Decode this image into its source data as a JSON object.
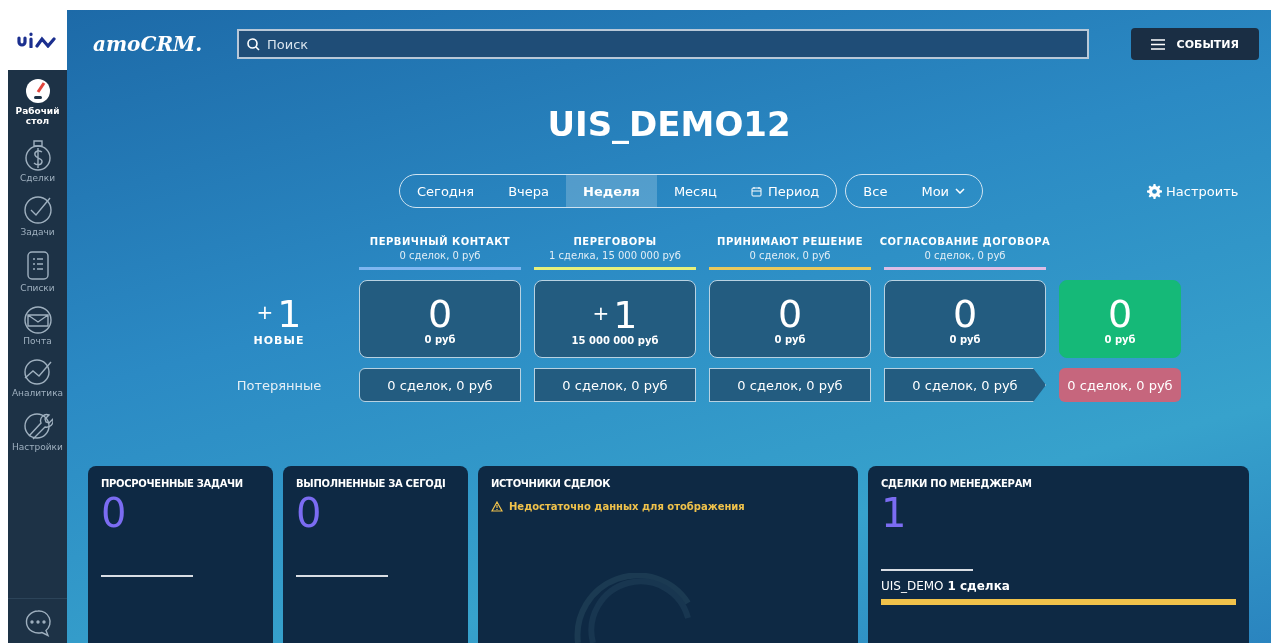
{
  "sidebar": {
    "items": [
      {
        "label": "Рабочий стол",
        "selected": true
      },
      {
        "label": "Сделки",
        "selected": false
      },
      {
        "label": "Задачи",
        "selected": false
      },
      {
        "label": "Списки",
        "selected": false
      },
      {
        "label": "Почта",
        "selected": false
      },
      {
        "label": "Аналитика",
        "selected": false
      },
      {
        "label": "Настройки",
        "selected": false
      }
    ]
  },
  "header": {
    "brand": "amoCRM.",
    "search": {
      "placeholder": "Поиск"
    },
    "events_button": "СОБЫТИЯ"
  },
  "title": "UIS_DEMO12",
  "period_tabs": [
    {
      "label": "Сегодня",
      "selected": false
    },
    {
      "label": "Вчера",
      "selected": false
    },
    {
      "label": "Неделя",
      "selected": true
    },
    {
      "label": "Месяц",
      "selected": false
    },
    {
      "label": "Период",
      "selected": false,
      "kind": "calendar"
    }
  ],
  "owner_tabs": [
    {
      "label": "Все",
      "selected": false
    },
    {
      "label": "Мои",
      "selected": false,
      "kind": "dropdown"
    }
  ],
  "configure_button": "Настроить",
  "new_deals": {
    "prefix": "+",
    "count": "1",
    "label": "НОВЫЕ"
  },
  "lost_label": "Потерянные",
  "stages": [
    {
      "name": "ПЕРВИЧНЫЙ КОНТАКТ",
      "summary": "0 сделок, 0 руб",
      "color": "#7fb6f0",
      "count": "0",
      "amount": "0 руб",
      "lost": "0 сделок, 0 руб"
    },
    {
      "name": "ПЕРЕГОВОРЫ",
      "summary": "1 сделка, 15 000 000 руб",
      "color": "#e6f07c",
      "prefix": "+",
      "count": "1",
      "amount": "15 000 000 руб",
      "lost": "0 сделок, 0 руб"
    },
    {
      "name": "ПРИНИМАЮТ РЕШЕНИЕ",
      "summary": "0 сделок, 0 руб",
      "color": "#e8c95c",
      "count": "0",
      "amount": "0 руб",
      "lost": "0 сделок, 0 руб"
    },
    {
      "name": "СОГЛАСОВАНИЕ ДОГОВОРА",
      "summary": "0 сделок, 0 руб",
      "color": "#dcbde6",
      "count": "0",
      "amount": "0 руб",
      "lost": "0 сделок, 0 руб"
    }
  ],
  "won": {
    "count": "0",
    "amount": "0 руб"
  },
  "lost": {
    "text": "0 сделок, 0 руб"
  },
  "widgets": [
    {
      "kind": "counter",
      "title": "ПРОСРОЧЕННЫЕ ЗАДАЧИ",
      "value": "0"
    },
    {
      "kind": "counter",
      "title": "ВЫПОЛНЕННЫЕ ЗА СЕГОДІ",
      "value": "0"
    },
    {
      "kind": "warning",
      "title": "ИСТОЧНИКИ СДЕЛОК",
      "message": "Недостаточно данных для отображения"
    },
    {
      "kind": "managers",
      "title": "СДЕЛКИ ПО МЕНЕДЖЕРАМ",
      "value": "1",
      "row": "UIS_DEMO **1 сделка**"
    }
  ]
}
